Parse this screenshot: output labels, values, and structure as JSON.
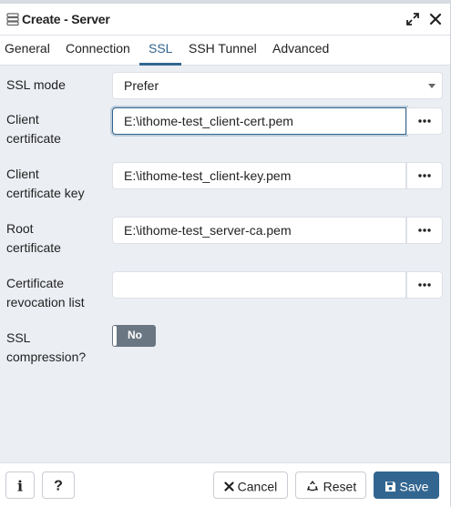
{
  "dialog": {
    "title": "Create - Server"
  },
  "tabs": [
    {
      "label": "General"
    },
    {
      "label": "Connection"
    },
    {
      "label": "SSL",
      "active": true
    },
    {
      "label": "SSH Tunnel"
    },
    {
      "label": "Advanced"
    }
  ],
  "ssl": {
    "ssl_mode": {
      "label": "SSL mode",
      "value": "Prefer"
    },
    "client_certificate": {
      "label_line1": "Client",
      "label_line2": "certificate",
      "value": "E:\\ithome-test_client-cert.pem"
    },
    "client_certificate_key": {
      "label_line1": "Client",
      "label_line2": "certificate key",
      "value": "E:\\ithome-test_client-key.pem"
    },
    "root_certificate": {
      "label_line1": "Root",
      "label_line2": "certificate",
      "value": "E:\\ithome-test_server-ca.pem"
    },
    "crl": {
      "label_line1": "Certificate",
      "label_line2": "revocation list",
      "value": ""
    },
    "compression": {
      "label_line1": "SSL",
      "label_line2": "compression?",
      "toggle_text": "No",
      "enabled": false
    }
  },
  "footer": {
    "info_label": "i",
    "help_label": "?",
    "cancel_label": "Cancel",
    "reset_label": "Reset",
    "save_label": "Save"
  },
  "colors": {
    "accent": "#326690",
    "toggle_off": "#6b7683"
  },
  "icons": [
    "server-icon",
    "expand-icon",
    "close-icon",
    "more-icon",
    "info-icon",
    "help-icon",
    "cancel-x-icon",
    "reset-icon",
    "save-icon"
  ]
}
